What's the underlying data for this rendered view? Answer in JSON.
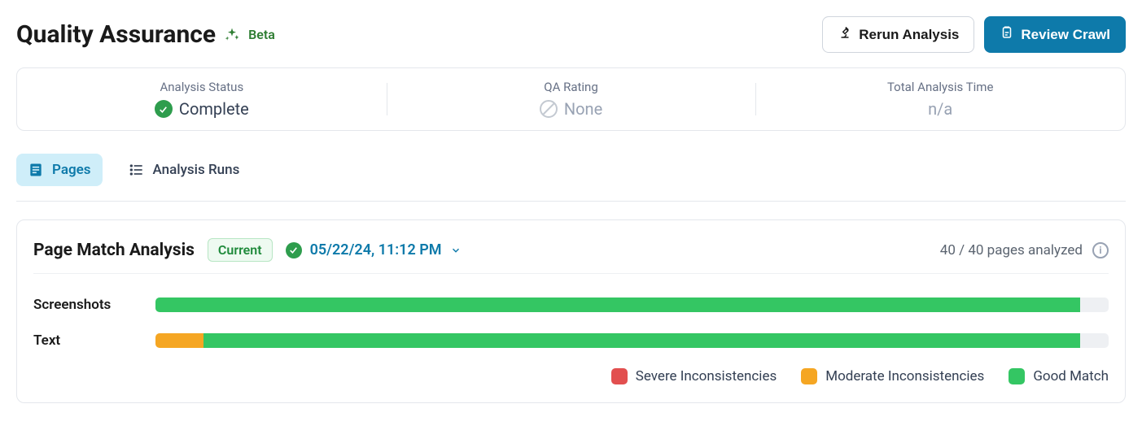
{
  "header": {
    "title": "Quality Assurance",
    "beta": "Beta",
    "rerun_label": "Rerun Analysis",
    "review_label": "Review Crawl"
  },
  "status": {
    "analysis_status_label": "Analysis Status",
    "analysis_status_value": "Complete",
    "qa_rating_label": "QA Rating",
    "qa_rating_value": "None",
    "total_time_label": "Total Analysis Time",
    "total_time_value": "n/a"
  },
  "tabs": {
    "pages": "Pages",
    "analysis_runs": "Analysis Runs"
  },
  "analysis": {
    "title": "Page Match Analysis",
    "current_badge": "Current",
    "run_timestamp": "05/22/24, 11:12 PM",
    "pages_analyzed": "40 / 40 pages analyzed"
  },
  "chart_data": {
    "type": "bar",
    "categories": [
      "Screenshots",
      "Text"
    ],
    "series": [
      {
        "name": "Severe Inconsistencies",
        "color": "#e24f4f",
        "values": [
          0,
          0
        ]
      },
      {
        "name": "Moderate Inconsistencies",
        "color": "#f5a623",
        "values": [
          0,
          5
        ]
      },
      {
        "name": "Good Match",
        "color": "#34c663",
        "values": [
          97,
          92
        ]
      }
    ],
    "xlim": [
      0,
      100
    ]
  },
  "legend": {
    "severe": "Severe Inconsistencies",
    "moderate": "Moderate Inconsistencies",
    "good": "Good Match"
  }
}
